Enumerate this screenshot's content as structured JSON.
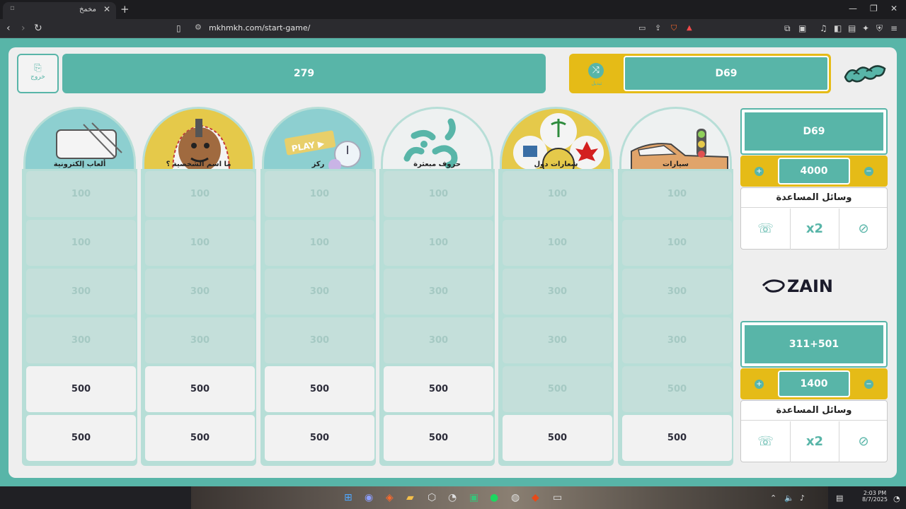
{
  "browser": {
    "tab_title": "مخمخ",
    "url": "mkhmkh.com/start-game/"
  },
  "header": {
    "exit_label": "خروج",
    "score_bar": "279",
    "turn_label": "D69",
    "turn_sub": "تبديل"
  },
  "categories": [
    {
      "title": "ألعاب إلكترونية",
      "cells": [
        {
          "value": "100",
          "active": false
        },
        {
          "value": "100",
          "active": false
        },
        {
          "value": "300",
          "active": false
        },
        {
          "value": "300",
          "active": false
        },
        {
          "value": "500",
          "active": true
        },
        {
          "value": "500",
          "active": true
        }
      ]
    },
    {
      "title": "ما اسم الشخصية ؟",
      "cells": [
        {
          "value": "100",
          "active": false
        },
        {
          "value": "100",
          "active": false
        },
        {
          "value": "300",
          "active": false
        },
        {
          "value": "300",
          "active": false
        },
        {
          "value": "500",
          "active": true
        },
        {
          "value": "500",
          "active": true
        }
      ]
    },
    {
      "title": "ركز",
      "cells": [
        {
          "value": "100",
          "active": false
        },
        {
          "value": "100",
          "active": false
        },
        {
          "value": "300",
          "active": false
        },
        {
          "value": "300",
          "active": false
        },
        {
          "value": "500",
          "active": true
        },
        {
          "value": "500",
          "active": true
        }
      ]
    },
    {
      "title": "حروف مبعثرة",
      "cells": [
        {
          "value": "100",
          "active": false
        },
        {
          "value": "100",
          "active": false
        },
        {
          "value": "300",
          "active": false
        },
        {
          "value": "300",
          "active": false
        },
        {
          "value": "500",
          "active": true
        },
        {
          "value": "500",
          "active": true
        }
      ]
    },
    {
      "title": "شعارات دول",
      "cells": [
        {
          "value": "100",
          "active": false
        },
        {
          "value": "100",
          "active": false
        },
        {
          "value": "300",
          "active": false
        },
        {
          "value": "300",
          "active": false
        },
        {
          "value": "500",
          "active": false
        },
        {
          "value": "500",
          "active": true
        }
      ]
    },
    {
      "title": "سيارات",
      "cells": [
        {
          "value": "100",
          "active": false
        },
        {
          "value": "100",
          "active": false
        },
        {
          "value": "300",
          "active": false
        },
        {
          "value": "300",
          "active": false
        },
        {
          "value": "500",
          "active": false
        },
        {
          "value": "500",
          "active": true
        }
      ]
    }
  ],
  "team1": {
    "name": "D69",
    "score": "4000",
    "aids_title": "وسائل المساعدة"
  },
  "team2": {
    "name": "311+501",
    "score": "1400",
    "aids_title": "وسائل المساعدة"
  },
  "aid_icons": [
    "call-friend-icon",
    "double-points-icon",
    "skip-icon"
  ],
  "aid_double_text": "x2",
  "sponsor": "ZAIN",
  "system": {
    "time": "2:03 PM",
    "date": "8/7/2025"
  },
  "colors": {
    "teal": "#58b5a8",
    "yellow": "#e5bb17",
    "cell_inactive": "#c4dfda",
    "cell_active": "#f2f2f2"
  }
}
